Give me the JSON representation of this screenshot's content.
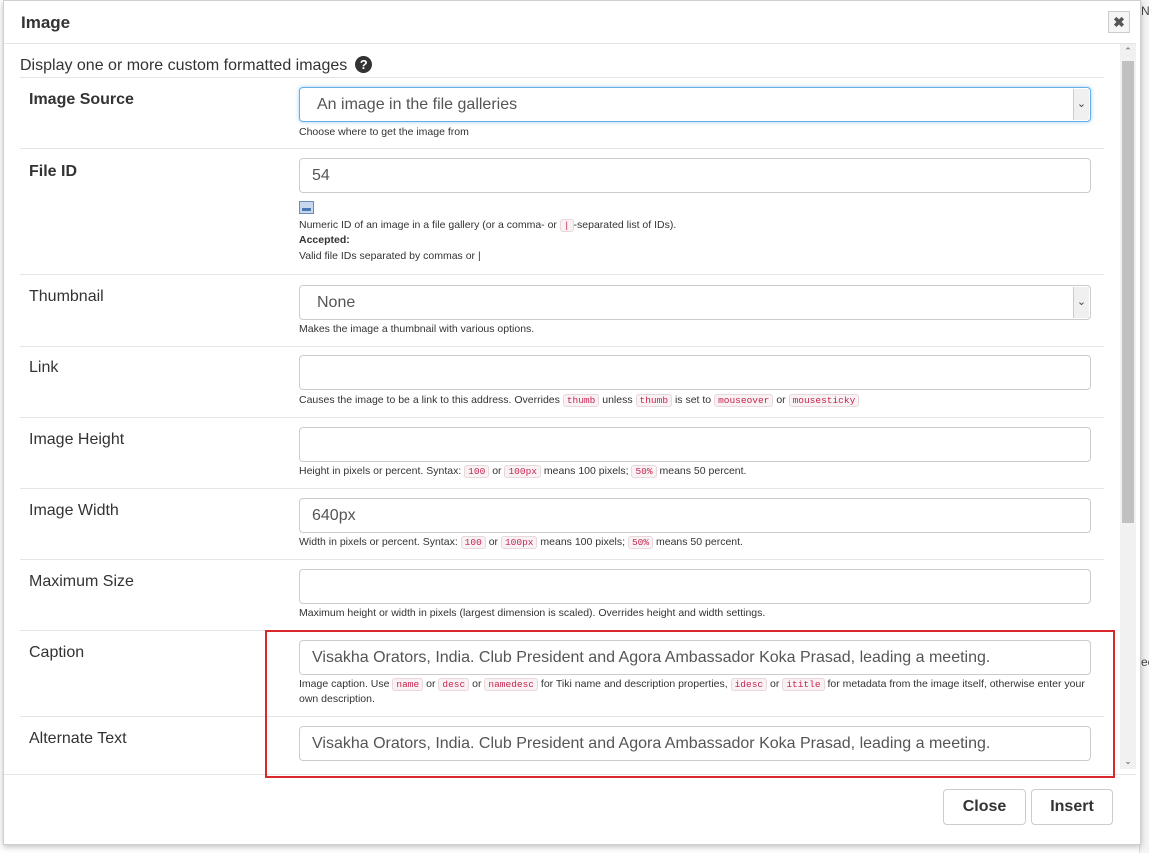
{
  "dialog": {
    "title": "Image",
    "close_icon": "close-icon",
    "intro": "Display one or more custom formatted images",
    "help_icon": "question-circle-icon"
  },
  "fields": {
    "image_source": {
      "label": "Image Source",
      "value": "An image in the file galleries",
      "help": "Choose where to get the image from"
    },
    "file_id": {
      "label": "File ID",
      "value": "54",
      "help_pre": "Numeric ID of an image in a file gallery (or a comma- or ",
      "help_code": "|",
      "help_post": "-separated list of IDs).",
      "accepted_label": "Accepted:",
      "accepted_text": "Valid file IDs separated by commas or |"
    },
    "thumbnail": {
      "label": "Thumbnail",
      "value": "None",
      "help": "Makes the image a thumbnail with various options."
    },
    "link": {
      "label": "Link",
      "value": "",
      "help_1": "Causes the image to be a link to this address. Overrides",
      "code_1": "thumb",
      "help_2": "unless",
      "code_2": "thumb",
      "help_3": "is set to",
      "code_3": "mouseover",
      "help_4": "or",
      "code_4": "mousesticky"
    },
    "image_height": {
      "label": "Image Height",
      "value": "",
      "help_1": "Height in pixels or percent. Syntax:",
      "code_1": "100",
      "help_2": "or",
      "code_2": "100px",
      "help_3": "means 100 pixels;",
      "code_3": "50%",
      "help_4": "means 50 percent."
    },
    "image_width": {
      "label": "Image Width",
      "value": "640px",
      "help_1": "Width in pixels or percent. Syntax:",
      "code_1": "100",
      "help_2": "or",
      "code_2": "100px",
      "help_3": "means 100 pixels;",
      "code_3": "50%",
      "help_4": "means 50 percent."
    },
    "maximum_size": {
      "label": "Maximum Size",
      "value": "",
      "help": "Maximum height or width in pixels (largest dimension is scaled). Overrides height and width settings."
    },
    "caption": {
      "label": "Caption",
      "value": "Visakha Orators, India.  Club President and Agora Ambassador Koka Prasad, leading a meeting.",
      "help_1": "Image caption. Use",
      "code_1": "name",
      "help_2": "or",
      "code_2": "desc",
      "help_3": "or",
      "code_3": "namedesc",
      "help_4": "for Tiki name and description properties,",
      "code_4": "idesc",
      "help_5": "or",
      "code_5": "ititle",
      "help_6": "for metadata from the image itself, otherwise enter your own description."
    },
    "alternate_text": {
      "label": "Alternate Text",
      "value": "Visakha Orators, India.  Club President and Agora Ambassador Koka Prasad, leading a meeting."
    }
  },
  "footer": {
    "close_label": "Close",
    "insert_label": "Insert"
  },
  "background": {
    "top_right_text": "Ne",
    "mid_right_text": "ec"
  },
  "colors": {
    "highlight_border": "#d9272e",
    "focus_border": "#66afe9",
    "code_text": "#c7254e"
  }
}
